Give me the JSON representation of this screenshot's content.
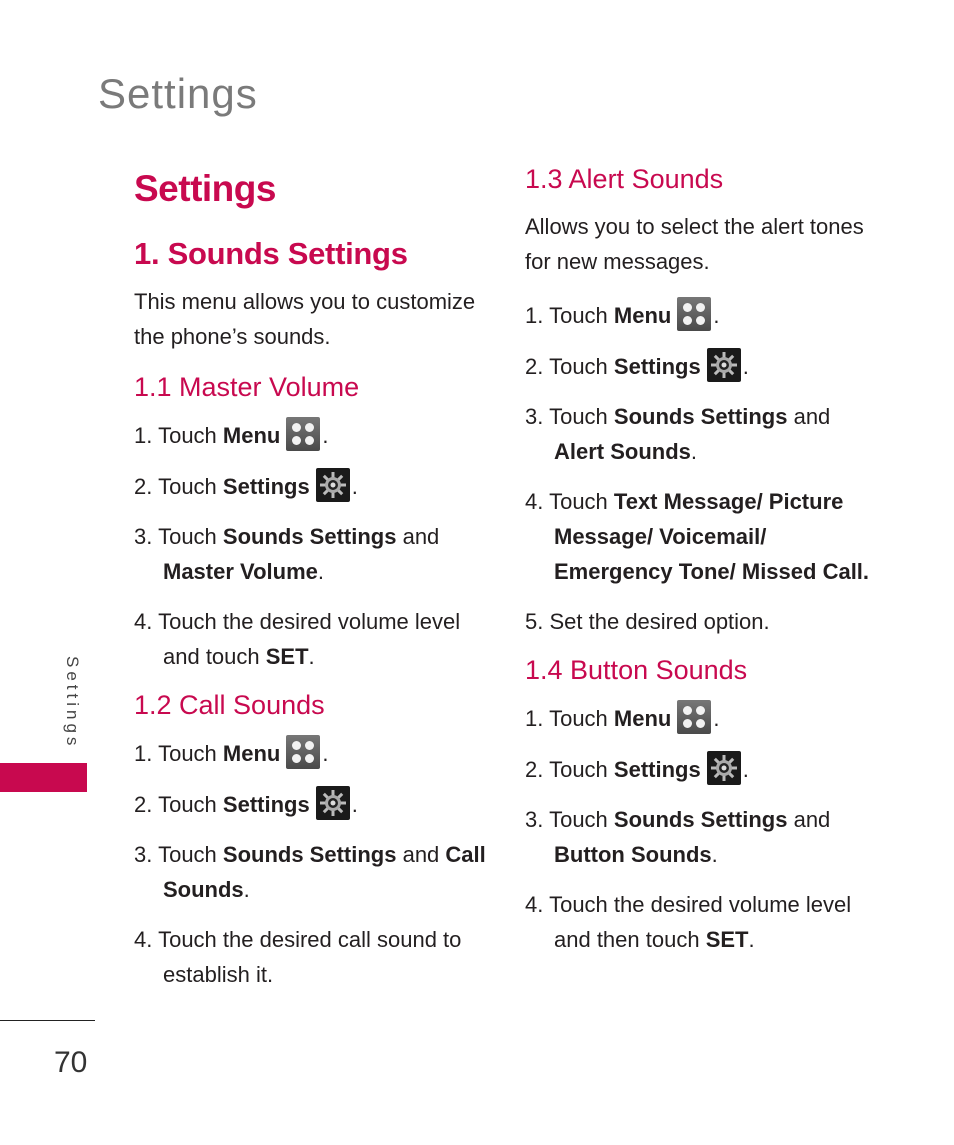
{
  "running_head": "Settings",
  "side_tab": {
    "label": "Settings",
    "accent_color": "#c8094f"
  },
  "page_number": "70",
  "colors": {
    "heading": "#c8094f",
    "running_head": "#7a7a7a",
    "body": "#231f20"
  },
  "section_title": "Settings",
  "subsection": {
    "title": "1. Sounds Settings",
    "intro": "This menu allows you to customize the phone’s sounds."
  },
  "sections": [
    {
      "heading": "1.1 Master Volume",
      "steps": [
        {
          "num": "1.",
          "pre": "Touch ",
          "bold": "Menu",
          "icon": "menu-icon",
          "post": "."
        },
        {
          "num": "2.",
          "pre": "Touch ",
          "bold": "Settings",
          "icon": "settings-gear-icon",
          "post": "."
        },
        {
          "num": "3.",
          "pre": "Touch ",
          "bold": "Sounds Settings",
          "mid": " and ",
          "bold2": "Master Volume",
          "post": "."
        },
        {
          "num": "4.",
          "pre": "Touch the desired volume level and touch ",
          "bold": "SET",
          "post": "."
        }
      ]
    },
    {
      "heading": "1.2 Call Sounds",
      "steps": [
        {
          "num": "1.",
          "pre": "Touch ",
          "bold": "Menu",
          "icon": "menu-icon",
          "post": "."
        },
        {
          "num": "2.",
          "pre": "Touch ",
          "bold": "Settings",
          "icon": "settings-gear-icon",
          "post": "."
        },
        {
          "num": "3.",
          "pre": "Touch ",
          "bold": "Sounds Settings",
          "mid": " and ",
          "bold2": "Call Sounds",
          "post": "."
        },
        {
          "num": "4.",
          "pre": "Touch the desired call sound to establish it.",
          "bold": "",
          "post": ""
        }
      ]
    },
    {
      "heading": "1.3 Alert Sounds",
      "intro": "Allows you to select the alert tones for new messages.",
      "steps": [
        {
          "num": "1.",
          "pre": "Touch ",
          "bold": "Menu",
          "icon": "menu-icon",
          "post": "."
        },
        {
          "num": "2.",
          "pre": "Touch ",
          "bold": "Settings",
          "icon": "settings-gear-icon",
          "post": "."
        },
        {
          "num": "3.",
          "pre": "Touch ",
          "bold": "Sounds Settings",
          "mid": " and ",
          "bold2": "Alert Sounds",
          "post": "."
        },
        {
          "num": "4.",
          "pre": "Touch ",
          "bold": "Text Message/ Picture Message/ Voicemail/ Emergency Tone/ Missed Call.",
          "post": ""
        },
        {
          "num": "5.",
          "pre": "Set the desired option.",
          "bold": "",
          "post": ""
        }
      ]
    },
    {
      "heading": "1.4 Button Sounds",
      "steps": [
        {
          "num": "1.",
          "pre": "Touch ",
          "bold": "Menu",
          "icon": "menu-icon",
          "post": "."
        },
        {
          "num": "2.",
          "pre": "Touch ",
          "bold": "Settings",
          "icon": "settings-gear-icon",
          "post": "."
        },
        {
          "num": "3.",
          "pre": "Touch ",
          "bold": "Sounds Settings",
          "mid": " and ",
          "bold2": "Button Sounds",
          "post": "."
        },
        {
          "num": "4.",
          "pre": "Touch the desired volume level and then touch ",
          "bold": "SET",
          "post": "."
        }
      ]
    }
  ]
}
